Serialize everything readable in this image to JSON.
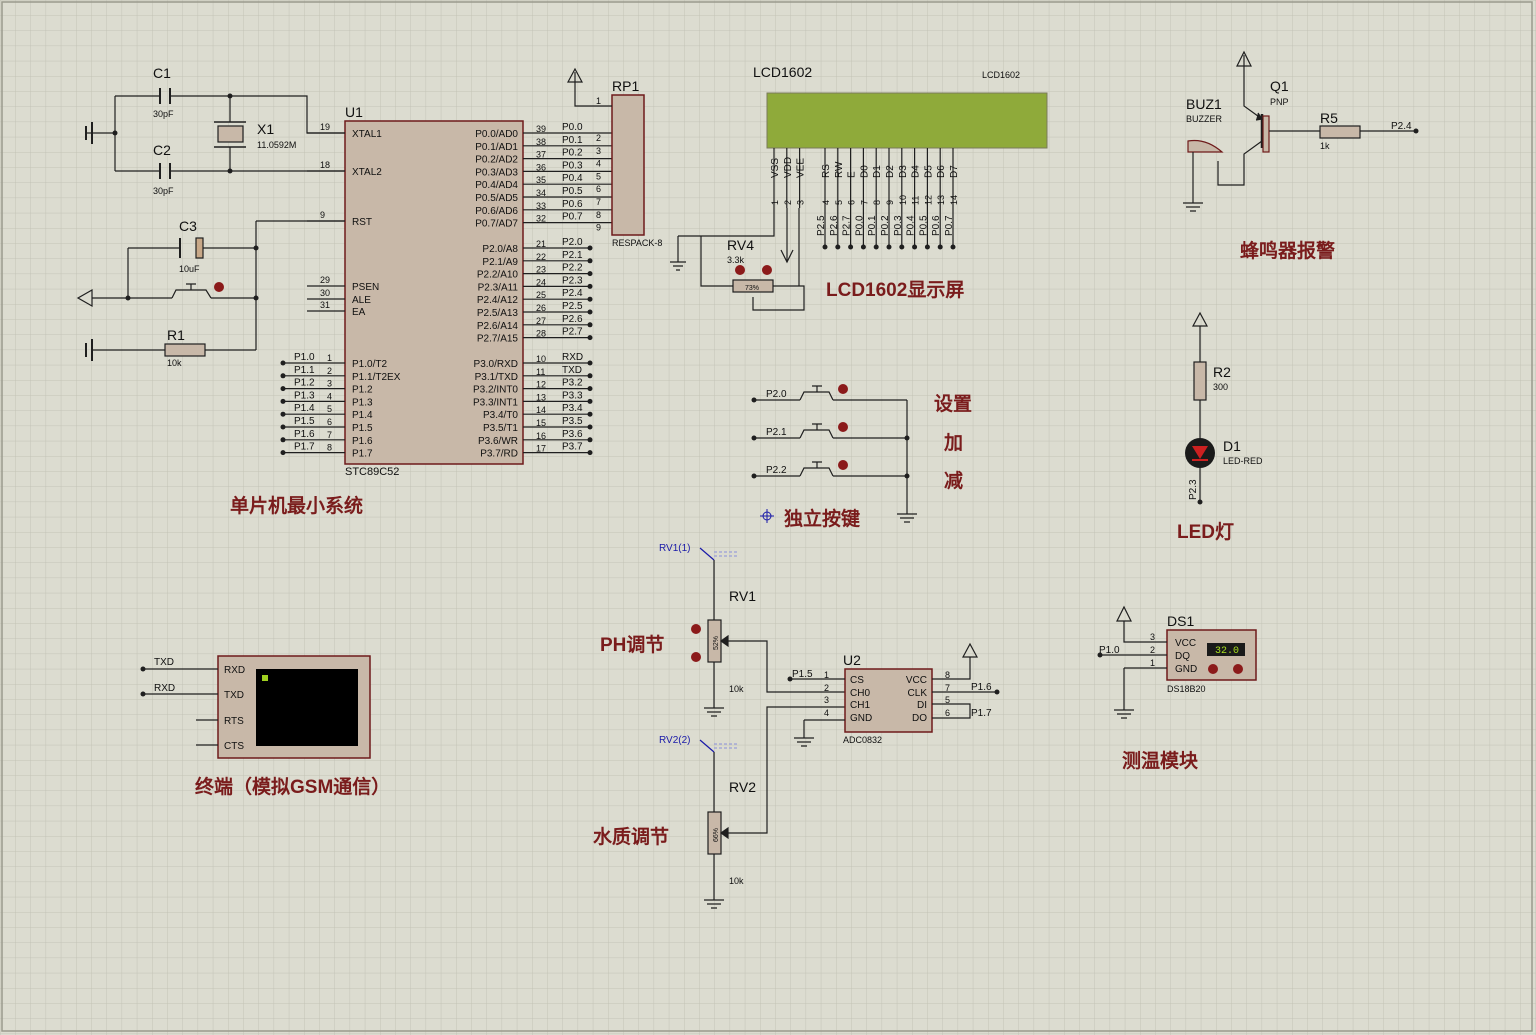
{
  "colors": {
    "background": "#dcdcd0",
    "grid": "#c3c3b6",
    "component_body": "#c8b8a8",
    "component_outline": "#6e1a1a",
    "wire": "#1f1f1f",
    "lcd_screen": "#8faa3a",
    "section_title": "#7a1c1c",
    "pin_dot": "#8b1a1a",
    "probe_label": "#1a1aa8"
  },
  "sections": {
    "mcu": "单片机最小系统",
    "lcd": "LCD1602显示屏",
    "keys": "独立按键",
    "key_set": "设置",
    "key_add": "加",
    "key_sub": "减",
    "buzzer": "蜂鸣器报警",
    "led": "LED灯",
    "terminal": "终端（模拟GSM通信）",
    "ph": "PH调节",
    "water": "水质调节",
    "temp": "测温模块"
  },
  "u1": {
    "ref": "U1",
    "part": "STC89C52",
    "left_pins": [
      {
        "num": "19",
        "name": "XTAL1"
      },
      {
        "num": "18",
        "name": "XTAL2"
      },
      {
        "num": "9",
        "name": "RST"
      },
      {
        "num": "29",
        "name": "PSEN"
      },
      {
        "num": "30",
        "name": "ALE"
      },
      {
        "num": "31",
        "name": "EA"
      }
    ],
    "p1_pins": [
      {
        "num": "1",
        "name": "P1.0/T2",
        "net": "P1.0"
      },
      {
        "num": "2",
        "name": "P1.1/T2EX",
        "net": "P1.1"
      },
      {
        "num": "3",
        "name": "P1.2",
        "net": "P1.2"
      },
      {
        "num": "4",
        "name": "P1.3",
        "net": "P1.3"
      },
      {
        "num": "5",
        "name": "P1.4",
        "net": "P1.4"
      },
      {
        "num": "6",
        "name": "P1.5",
        "net": "P1.5"
      },
      {
        "num": "7",
        "name": "P1.6",
        "net": "P1.6"
      },
      {
        "num": "8",
        "name": "P1.7",
        "net": "P1.7"
      }
    ],
    "p0_pins": [
      {
        "num": "39",
        "name": "P0.0/AD0",
        "net": "P0.0"
      },
      {
        "num": "38",
        "name": "P0.1/AD1",
        "net": "P0.1"
      },
      {
        "num": "37",
        "name": "P0.2/AD2",
        "net": "P0.2"
      },
      {
        "num": "36",
        "name": "P0.3/AD3",
        "net": "P0.3"
      },
      {
        "num": "35",
        "name": "P0.4/AD4",
        "net": "P0.4"
      },
      {
        "num": "34",
        "name": "P0.5/AD5",
        "net": "P0.5"
      },
      {
        "num": "33",
        "name": "P0.6/AD6",
        "net": "P0.6"
      },
      {
        "num": "32",
        "name": "P0.7/AD7",
        "net": "P0.7"
      }
    ],
    "p2_pins": [
      {
        "num": "21",
        "name": "P2.0/A8",
        "net": "P2.0"
      },
      {
        "num": "22",
        "name": "P2.1/A9",
        "net": "P2.1"
      },
      {
        "num": "23",
        "name": "P2.2/A10",
        "net": "P2.2"
      },
      {
        "num": "24",
        "name": "P2.3/A11",
        "net": "P2.3"
      },
      {
        "num": "25",
        "name": "P2.4/A12",
        "net": "P2.4"
      },
      {
        "num": "26",
        "name": "P2.5/A13",
        "net": "P2.5"
      },
      {
        "num": "27",
        "name": "P2.6/A14",
        "net": "P2.6"
      },
      {
        "num": "28",
        "name": "P2.7/A15",
        "net": "P2.7"
      }
    ],
    "p3_pins": [
      {
        "num": "10",
        "name": "P3.0/RXD",
        "net": "RXD"
      },
      {
        "num": "11",
        "name": "P3.1/TXD",
        "net": "TXD"
      },
      {
        "num": "12",
        "name": "P3.2/INT0",
        "net": "P3.2"
      },
      {
        "num": "13",
        "name": "P3.3/INT1",
        "net": "P3.3"
      },
      {
        "num": "14",
        "name": "P3.4/T0",
        "net": "P3.4"
      },
      {
        "num": "15",
        "name": "P3.5/T1",
        "net": "P3.5"
      },
      {
        "num": "16",
        "name": "P3.6/WR",
        "net": "P3.6"
      },
      {
        "num": "17",
        "name": "P3.7/RD",
        "net": "P3.7"
      }
    ]
  },
  "crystal": {
    "c1": "C1",
    "c1_val": "30pF",
    "c2": "C2",
    "c2_val": "30pF",
    "x1": "X1",
    "x1_val": "11.0592M"
  },
  "reset": {
    "c3": "C3",
    "c3_val": "10uF",
    "r1": "R1",
    "r1_val": "10k"
  },
  "rp1": {
    "ref": "RP1",
    "part": "RESPACK-8",
    "pin_nums": [
      "1",
      "2",
      "3",
      "4",
      "5",
      "6",
      "7",
      "8",
      "9"
    ]
  },
  "lcd": {
    "title": "LCD1602",
    "title_small": "LCD1602",
    "pins": [
      "VSS",
      "VDD",
      "VEE",
      "RS",
      "RW",
      "E",
      "D0",
      "D1",
      "D2",
      "D3",
      "D4",
      "D5",
      "D6",
      "D7"
    ],
    "pin_nums": [
      "1",
      "2",
      "3",
      "4",
      "5",
      "6",
      "7",
      "8",
      "9",
      "10",
      "11",
      "12",
      "13",
      "14"
    ],
    "nets": [
      "P2.5",
      "P2.6",
      "P2.7",
      "P0.0",
      "P0.1",
      "P0.2",
      "P0.3",
      "P0.4",
      "P0.5",
      "P0.6",
      "P0.7"
    ]
  },
  "rv4": {
    "ref": "RV4",
    "val": "3.3k",
    "pct": "73%"
  },
  "keys": {
    "nets": [
      "P2.0",
      "P2.1",
      "P2.2"
    ]
  },
  "buzzer": {
    "ref": "BUZ1",
    "part": "BUZZER",
    "q1": "Q1",
    "q1_type": "PNP",
    "r5": "R5",
    "r5_val": "1k",
    "net": "P2.4"
  },
  "led": {
    "r2": "R2",
    "r2_val": "300",
    "d1": "D1",
    "d1_part": "LED-RED",
    "net": "P2.3"
  },
  "terminal": {
    "pins": [
      "RXD",
      "TXD",
      "RTS",
      "CTS"
    ],
    "nets": [
      "TXD",
      "RXD"
    ]
  },
  "rv1": {
    "ref": "RV1",
    "val": "10k",
    "probe": "RV1(1)",
    "pct": "52%"
  },
  "rv2": {
    "ref": "RV2",
    "val": "10k",
    "probe": "RV2(2)",
    "pct": "66%"
  },
  "adc": {
    "ref": "U2",
    "part": "ADC0832",
    "left_pins": [
      {
        "num": "1",
        "name": "CS"
      },
      {
        "num": "2",
        "name": "CH0"
      },
      {
        "num": "3",
        "name": "CH1"
      },
      {
        "num": "4",
        "name": "GND"
      }
    ],
    "right_pins": [
      {
        "num": "8",
        "name": "VCC"
      },
      {
        "num": "7",
        "name": "CLK"
      },
      {
        "num": "5",
        "name": "DI"
      },
      {
        "num": "6",
        "name": "DO"
      }
    ],
    "nets": [
      "P1.5",
      "P1.6",
      "P1.7"
    ]
  },
  "ds1": {
    "ref": "DS1",
    "part": "DS18B20",
    "pins": [
      "VCC",
      "DQ",
      "GND"
    ],
    "pin_nums": [
      "3",
      "2",
      "1"
    ],
    "reading": "32.0",
    "net": "P1.0"
  }
}
